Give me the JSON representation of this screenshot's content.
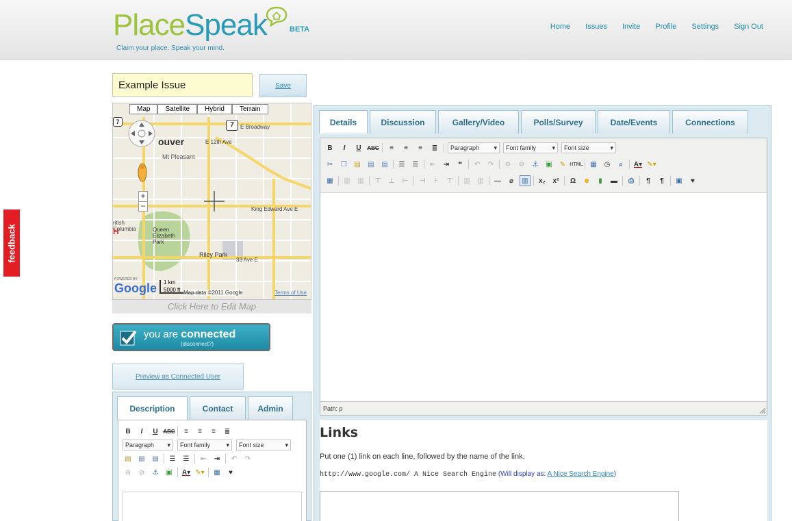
{
  "header": {
    "logo_part1": "Place",
    "logo_part2": "Speak",
    "logo_beta": "BETA",
    "tagline": "Claim your place. Speak your mind.",
    "nav": [
      "Home",
      "Issues",
      "Invite",
      "Profile",
      "Settings",
      "Sign Out"
    ]
  },
  "feedback_label": "feedback",
  "issue": {
    "title_value": "Example Issue",
    "save_label": "Save"
  },
  "map": {
    "types": [
      "Map",
      "Satellite",
      "Hybrid",
      "Terrain"
    ],
    "labels": {
      "city": "ouver",
      "mt_pleasant": "Mt Pleasant",
      "e_broadway": "E Broadway",
      "route7": "7",
      "e12th": "E 12th Ave",
      "king_edward": "King Edward Ave E",
      "queen_elizabeth": "Queen Elizabeth Park",
      "riley_park": "Riley Park",
      "e33rd": "33 Ave E",
      "alberta": "ritish Columbia"
    },
    "scale_km": "1 km",
    "scale_ft": "5000 ft",
    "attribution": "Map data ©2011 Google",
    "terms": "Terms of Use",
    "google": "Google",
    "powered_by": "POWERED BY",
    "edit_label": "Click Here to Edit Map"
  },
  "connection": {
    "prefix": "you are ",
    "bold": "connected",
    "sub": "(disconnect?)"
  },
  "preview_label": "Preview as Connected User",
  "desc_panel": {
    "tabs": [
      "Description",
      "Contact",
      "Admin"
    ],
    "format_select": "Paragraph",
    "font_family_select": "Font family",
    "font_size_select": "Font size"
  },
  "main_panel": {
    "tabs": [
      "Details",
      "Discussion",
      "Gallery/Video",
      "Polls/Survey",
      "Date/Events",
      "Connections"
    ],
    "format_select": "Paragraph",
    "font_family_select": "Font family",
    "font_size_select": "Font size",
    "path_label": "Path: p"
  },
  "links": {
    "title": "Links",
    "instructions": "Put one (1) link on each line, followed by the name of the link.",
    "example_code": "http://www.google.com/ A Nice Search Engine",
    "example_note": "(Will display as: ",
    "example_link": "A Nice Search Engine",
    "example_close": ")"
  },
  "colors": {
    "brand_green": "#9dc33b",
    "brand_blue": "#2a9bb7",
    "feedback_red": "#e21d24",
    "panel_bg": "#dbe9f1"
  }
}
